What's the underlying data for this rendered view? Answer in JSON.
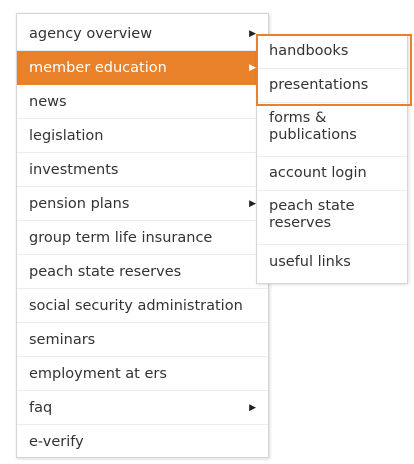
{
  "menu": {
    "items": [
      {
        "label": "agency overview",
        "has_submenu": true,
        "active": false
      },
      {
        "label": "member education",
        "has_submenu": true,
        "active": true
      },
      {
        "label": "news",
        "has_submenu": false,
        "active": false
      },
      {
        "label": "legislation",
        "has_submenu": false,
        "active": false
      },
      {
        "label": "investments",
        "has_submenu": false,
        "active": false
      },
      {
        "label": "pension plans",
        "has_submenu": true,
        "active": false
      },
      {
        "label": "group term life insurance",
        "has_submenu": false,
        "active": false
      },
      {
        "label": "peach state reserves",
        "has_submenu": false,
        "active": false
      },
      {
        "label": "social security administration",
        "has_submenu": false,
        "active": false
      },
      {
        "label": "seminars",
        "has_submenu": false,
        "active": false
      },
      {
        "label": "employment at ers",
        "has_submenu": false,
        "active": false
      },
      {
        "label": "faq",
        "has_submenu": true,
        "active": false
      },
      {
        "label": "e-verify",
        "has_submenu": false,
        "active": false
      }
    ],
    "arrow_glyph": "▶"
  },
  "submenu": {
    "items": [
      {
        "label": "handbooks"
      },
      {
        "label": "presentations"
      },
      {
        "label": "forms & publications"
      },
      {
        "label": "account login"
      },
      {
        "label": "peach state reserves"
      },
      {
        "label": "useful links"
      }
    ]
  },
  "colors": {
    "accent": "#e8812a",
    "border": "#d5d5d5",
    "text": "#333333"
  }
}
